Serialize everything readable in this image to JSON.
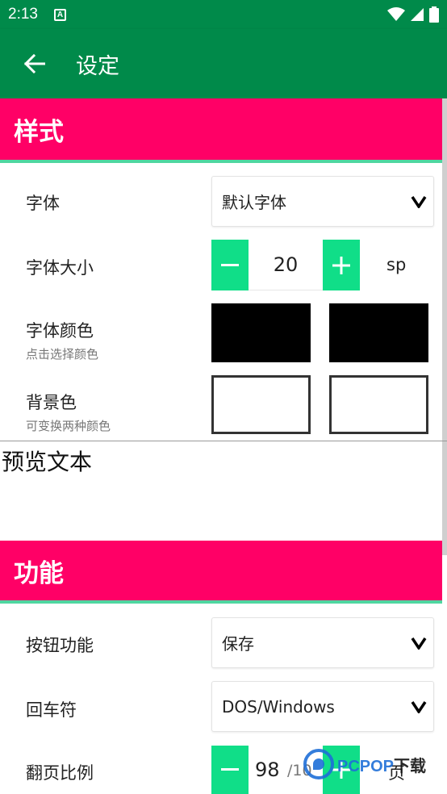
{
  "status_bar": {
    "time": "2:13",
    "notif_icon": "A"
  },
  "app_bar": {
    "title": "设定"
  },
  "sections": {
    "style": {
      "title": "样式"
    },
    "function": {
      "title": "功能"
    }
  },
  "font": {
    "label": "字体",
    "value": "默认字体"
  },
  "font_size": {
    "label": "字体大小",
    "value": "20",
    "unit": "sp"
  },
  "font_color": {
    "label": "字体颜色",
    "hint": "点击选择颜色",
    "colors": [
      "#000000",
      "#000000"
    ]
  },
  "bg_color": {
    "label": "背景色",
    "hint": "可变换两种颜色",
    "colors": [
      "#ffffff",
      "#ffffff"
    ]
  },
  "preview": {
    "text": "预览文本"
  },
  "button_function": {
    "label": "按钮功能",
    "value": "保存"
  },
  "line_ending": {
    "label": "回车符",
    "value": "DOS/Windows"
  },
  "page_ratio": {
    "label": "翻页比例",
    "value": "98",
    "suffix": "/10",
    "unit": "页"
  },
  "watermark": {
    "brand": "PCPOP",
    "suffix": "下载"
  },
  "colors": {
    "primary": "#008a4a",
    "section": "#ff0066",
    "accent": "#10de88",
    "divider": "#4fd6a0"
  }
}
